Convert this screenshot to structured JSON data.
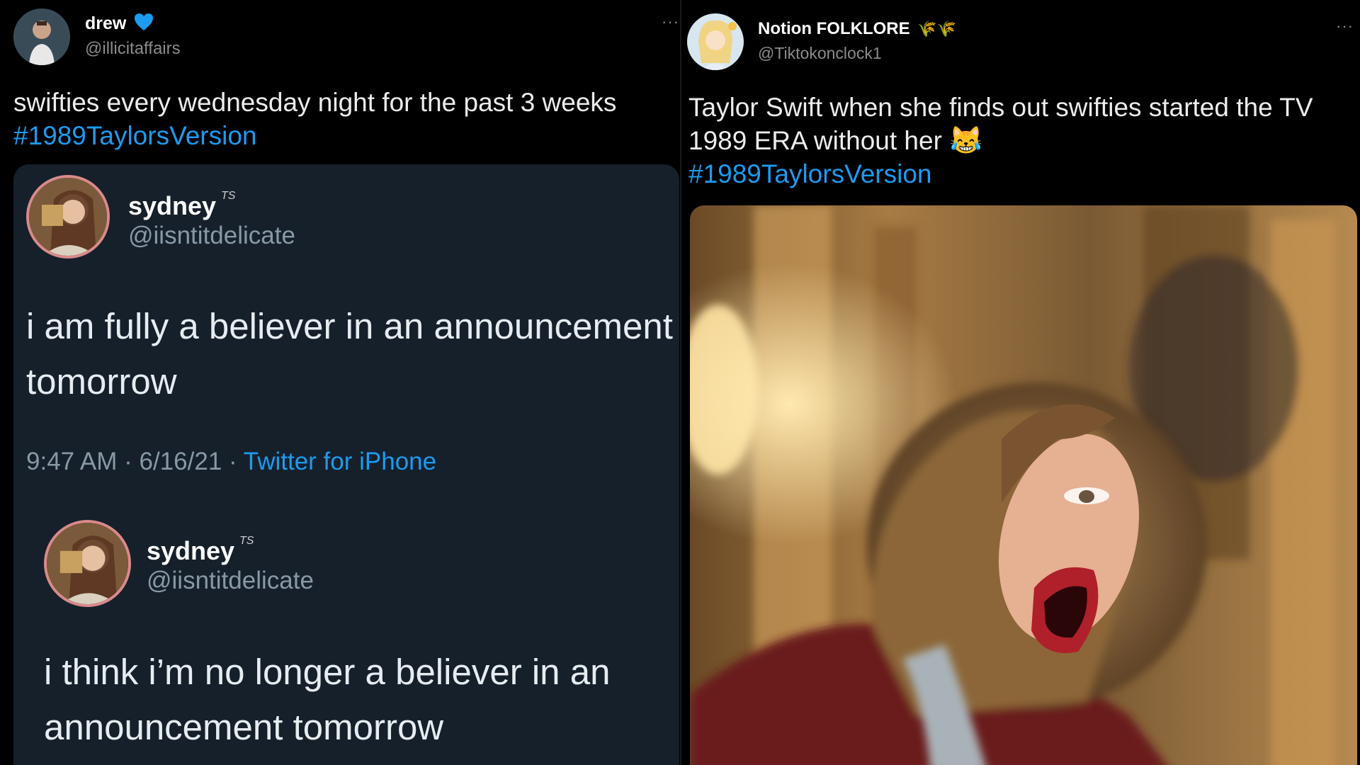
{
  "left_tweet": {
    "author_name": "drew",
    "author_handle": "@illicitaffairs",
    "more_label": "···",
    "text": "swifties every wednesday night for the past 3 weeks",
    "hashtag": "#1989TaylorsVersion",
    "quote": {
      "first": {
        "name": "sydney",
        "ts_mark": "TS",
        "handle": "@iisntitdelicate",
        "text_line1": "i am fully a believer in an announcement",
        "text_line2": "tomorrow",
        "time": "9:47 AM · 6/16/21 · ",
        "source": "Twitter for iPhone"
      },
      "second": {
        "name": "sydney",
        "ts_mark": "TS",
        "handle": "@iisntitdelicate",
        "text_line1": "i think i’m no longer a believer in an",
        "text_line2": "announcement tomorrow"
      }
    }
  },
  "right_tweet": {
    "author_name": "Notion FOLKLORE",
    "name_emoji": "🌾🌾",
    "author_handle": "@Tiktokonclock1",
    "more_label": "···",
    "text_line1": "Taylor Swift when she finds out swifties started the TV",
    "text_line2": "1989 ERA without her",
    "emoji": "😹",
    "hashtag": "#1989TaylorsVersion"
  },
  "colors": {
    "background": "#000000",
    "hashtag_blue": "#1d9bf0",
    "verified_blue": "#1d9bf0",
    "quote_bg": "#15202b"
  }
}
